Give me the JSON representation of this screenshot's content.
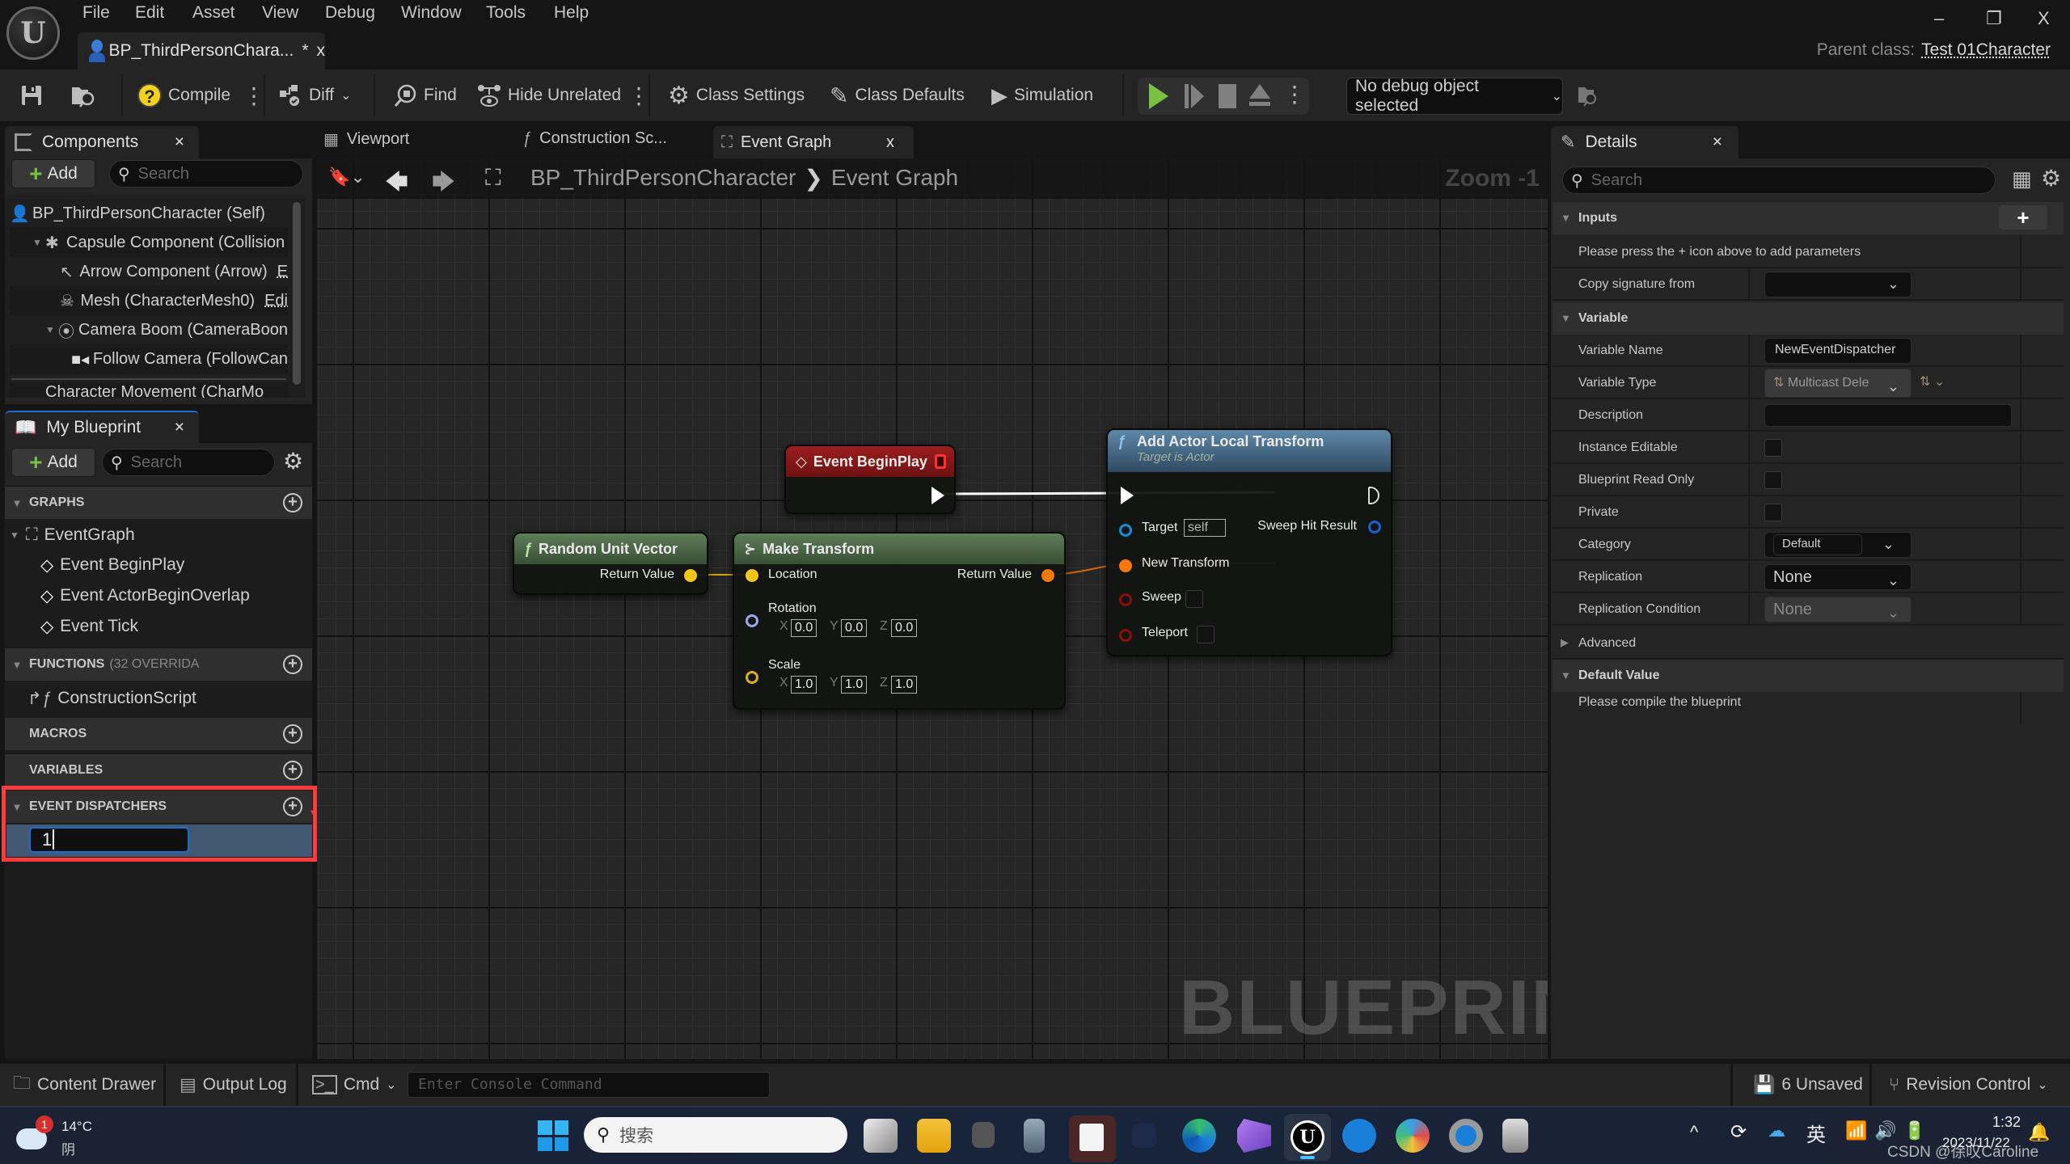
{
  "menu": [
    "File",
    "Edit",
    "Asset",
    "View",
    "Debug",
    "Window",
    "Tools",
    "Help"
  ],
  "document_tab": {
    "title": "BP_ThirdPersonChara...",
    "modified": "*",
    "close": "x"
  },
  "parent_class": {
    "label": "Parent class:",
    "value": "Test 01Character"
  },
  "window_controls": {
    "minimize": "–",
    "restore": "❐",
    "close": "X"
  },
  "toolbar": {
    "compile": "Compile",
    "diff": "Diff",
    "find": "Find",
    "hide_unrelated": "Hide Unrelated",
    "class_settings": "Class Settings",
    "class_defaults": "Class Defaults",
    "simulation": "Simulation",
    "debug_object": "No debug object selected"
  },
  "components_panel": {
    "title": "Components",
    "add_label": "Add",
    "search_placeholder": "Search",
    "items": [
      {
        "label": "BP_ThirdPersonCharacter (Self)"
      },
      {
        "label": "Capsule Component (Collision"
      },
      {
        "label": "Arrow Component (Arrow)",
        "edit": "E"
      },
      {
        "label": "Mesh (CharacterMesh0)",
        "edit": "Edi"
      },
      {
        "label": "Camera Boom (CameraBoon"
      },
      {
        "label": "Follow Camera (FollowCan"
      },
      {
        "label": "Character Movement (CharMo"
      }
    ]
  },
  "my_blueprint": {
    "title": "My Blueprint",
    "add_label": "Add",
    "search_placeholder": "Search",
    "sections": {
      "graphs": "GRAPHS",
      "functions": "FUNCTIONS",
      "functions_count": "(32 OVERRIDA",
      "macros": "MACROS",
      "variables": "VARIABLES",
      "event_dispatchers": "EVENT DISPATCHERS"
    },
    "graph_items": {
      "event_graph": "EventGraph",
      "events": [
        "Event BeginPlay",
        "Event ActorBeginOverlap",
        "Event Tick"
      ]
    },
    "function_items": [
      "ConstructionScript"
    ],
    "new_dispatcher_value": "1"
  },
  "editor_tabs": [
    {
      "label": "Viewport"
    },
    {
      "label": "Construction Sc..."
    },
    {
      "label": "Event Graph",
      "close": "x"
    }
  ],
  "breadcrumb": {
    "root": "BP_ThirdPersonCharacter",
    "separator": "❯",
    "current": "Event Graph"
  },
  "zoom_label": "Zoom -1",
  "watermark": "BLUEPRINT",
  "nodes": {
    "begin_play": {
      "title": "Event BeginPlay"
    },
    "random_unit_vector": {
      "title": "Random Unit Vector",
      "output": "Return Value"
    },
    "make_transform": {
      "title": "Make Transform",
      "location": "Location",
      "output": "Return Value",
      "rotation": "Rotation",
      "rotation_values": {
        "x": "0.0",
        "y": "0.0",
        "z": "0.0"
      },
      "scale": "Scale",
      "scale_values": {
        "x": "1.0",
        "y": "1.0",
        "z": "1.0"
      },
      "axis": {
        "x": "X",
        "y": "Y",
        "z": "Z"
      }
    },
    "add_actor_local_transform": {
      "title": "Add Actor Local Transform",
      "subtitle": "Target is Actor",
      "target": "Target",
      "target_value": "self",
      "sweep_hit_result": "Sweep Hit Result",
      "new_transform": "New Transform",
      "sweep": "Sweep",
      "teleport": "Teleport"
    }
  },
  "details": {
    "title": "Details",
    "search_placeholder": "Search",
    "inputs_section": "Inputs",
    "inputs_hint": "Please press the + icon above to add parameters",
    "copy_signature": "Copy signature from",
    "variable_section": "Variable",
    "variable_name_label": "Variable Name",
    "variable_name_value": "NewEventDispatcher",
    "variable_type_label": "Variable Type",
    "variable_type_value": "Multicast Dele",
    "description_label": "Description",
    "instance_editable": "Instance Editable",
    "blueprint_read_only": "Blueprint Read Only",
    "private": "Private",
    "category_label": "Category",
    "category_value": "Default",
    "replication_label": "Replication",
    "replication_value": "None",
    "replication_condition_label": "Replication Condition",
    "replication_condition_value": "None",
    "advanced_section": "Advanced",
    "default_value_section": "Default Value",
    "default_value_hint": "Please compile the blueprint"
  },
  "statusbar": {
    "content_drawer": "Content Drawer",
    "output_log": "Output Log",
    "cmd": "Cmd",
    "console_placeholder": "Enter Console Command",
    "unsaved": "6 Unsaved",
    "revision_control": "Revision Control"
  },
  "taskbar": {
    "weather_temp": "14°C",
    "weather_desc": "阴",
    "weather_badge": "1",
    "search_placeholder": "搜索",
    "ime": "英",
    "time": "1:32",
    "date": "2023/11/22",
    "watermark": "CSDN @徐叹Caroline"
  },
  "colors": {
    "accent_blue": "#1b6fd1",
    "play_green": "#7ac142",
    "exec_white": "#ffffff",
    "vector_pin": "#f5c518",
    "transform_pin": "#f57a0a",
    "object_pin": "#1a8fd6",
    "bool_pin": "#8a0f0f",
    "rotator_pin": "#9aa8e6",
    "event_header": "#8a1a1a",
    "pure_header": "#4d6b48",
    "function_header": "#4b6d86",
    "highlight_red": "#ff3b3b"
  }
}
